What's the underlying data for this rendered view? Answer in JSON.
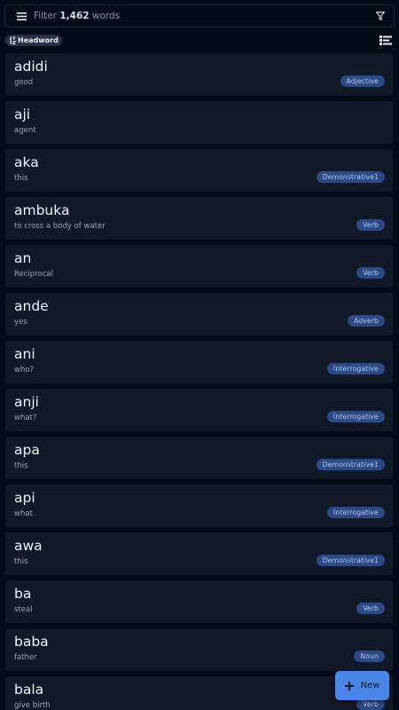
{
  "search": {
    "prefix": "Filter ",
    "count": "1,462",
    "suffix": " words"
  },
  "sort": {
    "label": "Headword"
  },
  "entries": [
    {
      "headword": "adidi",
      "gloss": "good",
      "pos": "Adjective"
    },
    {
      "headword": "aji",
      "gloss": "agent",
      "pos": ""
    },
    {
      "headword": "aka",
      "gloss": "this",
      "pos": "Demonstrative1"
    },
    {
      "headword": "ambuka",
      "gloss": "to cross a body of water",
      "pos": "Verb"
    },
    {
      "headword": "an",
      "gloss": "Reciprocal",
      "pos": "Verb"
    },
    {
      "headword": "ande",
      "gloss": "yes",
      "pos": "Adverb"
    },
    {
      "headword": "ani",
      "gloss": "who?",
      "pos": "Interrogative"
    },
    {
      "headword": "anji",
      "gloss": "what?",
      "pos": "Interrogative"
    },
    {
      "headword": "apa",
      "gloss": "this",
      "pos": "Demonstrative1"
    },
    {
      "headword": "api",
      "gloss": "what",
      "pos": "Interrogative"
    },
    {
      "headword": "awa",
      "gloss": "this",
      "pos": "Demonstrative1"
    },
    {
      "headword": "ba",
      "gloss": "steal",
      "pos": "Verb"
    },
    {
      "headword": "baba",
      "gloss": "father",
      "pos": "Noun"
    },
    {
      "headword": "bala",
      "gloss": "give birth",
      "pos": "Verb"
    }
  ],
  "fab": {
    "label": "New"
  },
  "icons": {
    "menu": "menu-icon",
    "filter": "filter-icon",
    "sort": "sort-az-icon",
    "view": "list-view-icon",
    "add": "plus-icon"
  },
  "colors": {
    "background": "#050a17",
    "card": "#111827",
    "badge": "#2b4a86",
    "accent": "#4a86e8"
  }
}
